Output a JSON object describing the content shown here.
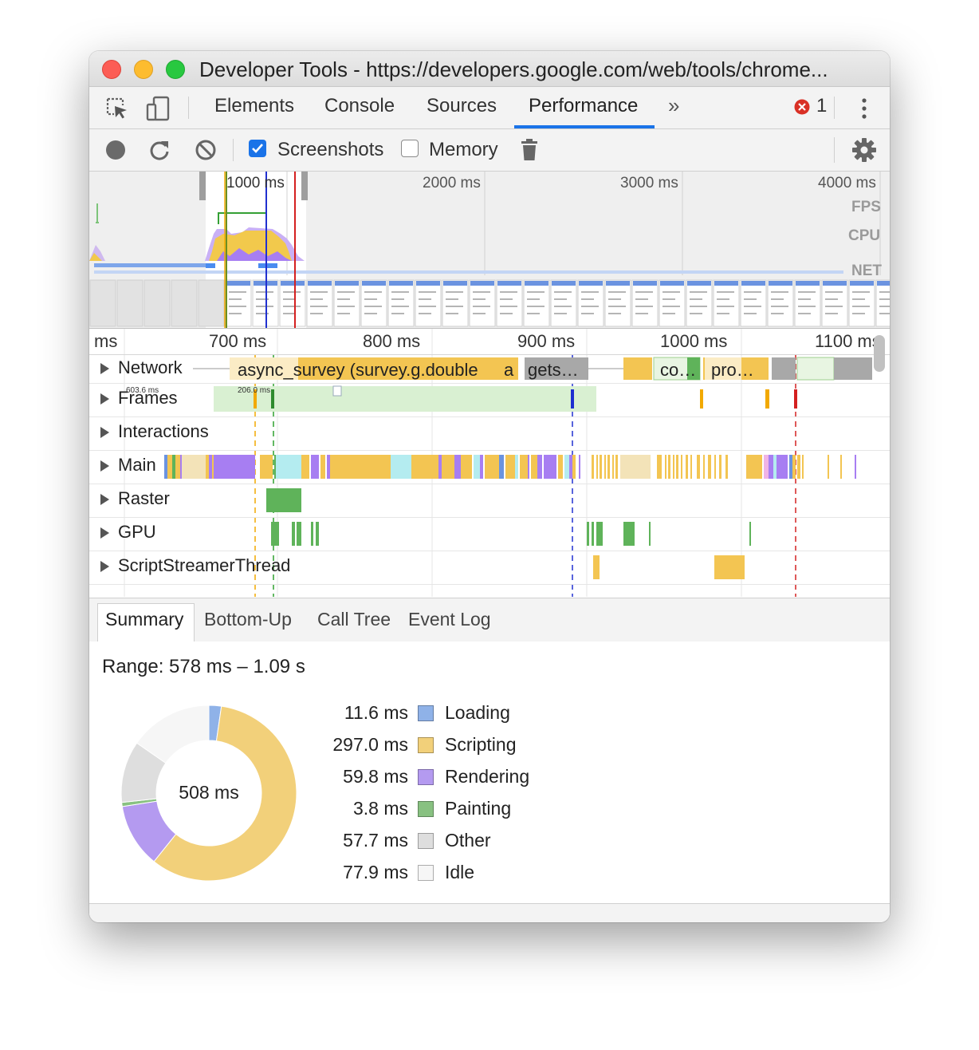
{
  "window": {
    "title": "Developer Tools - https://developers.google.com/web/tools/chrome..."
  },
  "tabs": {
    "items": [
      "Elements",
      "Console",
      "Sources",
      "Performance"
    ],
    "active": "Performance",
    "more": "»",
    "error_count": "1",
    "error_color": "#d93025",
    "accent": "#1a73e8"
  },
  "toolbar": {
    "screenshots_label": "Screenshots",
    "screenshots_checked": true,
    "memory_label": "Memory",
    "memory_checked": false
  },
  "overview": {
    "ticks": [
      "1000 ms",
      "2000 ms",
      "3000 ms",
      "4000 ms"
    ],
    "track_labels": [
      "FPS",
      "CPU",
      "NET"
    ]
  },
  "timeline": {
    "ruler_ticks": [
      "ms",
      "700 ms",
      "800 ms",
      "900 ms",
      "1000 ms",
      "1100 ms"
    ],
    "tracks": [
      "Network",
      "Frames",
      "Interactions",
      "Main",
      "Raster",
      "GPU",
      "ScriptStreamerThread"
    ],
    "network_items": [
      "async_survey (survey.g.double",
      "a",
      "gets…",
      "co…",
      "pro…"
    ],
    "frame_times": [
      "603.6 ms",
      "206.0 ms"
    ]
  },
  "bottom_tabs": {
    "items": [
      "Summary",
      "Bottom-Up",
      "Call Tree",
      "Event Log"
    ],
    "active": "Summary"
  },
  "summary": {
    "range": "Range: 578 ms – 1.09 s",
    "total": "508 ms",
    "categories": [
      {
        "value": "11.6 ms",
        "name": "Loading",
        "ms": 11.6,
        "color": "#8fb2e8"
      },
      {
        "value": "297.0 ms",
        "name": "Scripting",
        "ms": 297.0,
        "color": "#f2d07a"
      },
      {
        "value": "59.8 ms",
        "name": "Rendering",
        "ms": 59.8,
        "color": "#b49af0"
      },
      {
        "value": "3.8 ms",
        "name": "Painting",
        "ms": 3.8,
        "color": "#88c181"
      },
      {
        "value": "57.7 ms",
        "name": "Other",
        "ms": 57.7,
        "color": "#dedede"
      },
      {
        "value": "77.9 ms",
        "name": "Idle",
        "ms": 77.9,
        "color": "#f6f6f6"
      }
    ]
  }
}
